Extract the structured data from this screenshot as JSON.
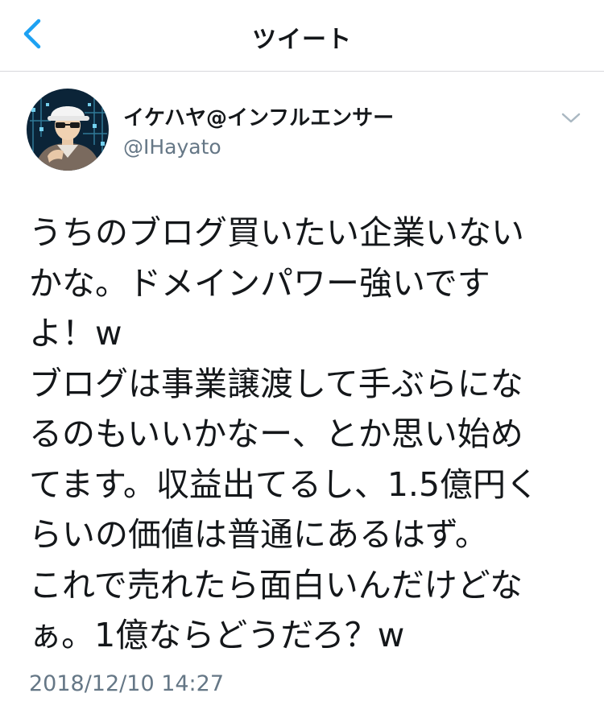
{
  "nav": {
    "title": "ツイート",
    "back_icon": "chevron-left-icon",
    "accent_color": "#1da1f2"
  },
  "tweet": {
    "display_name": "イケハヤ@インフルエンサー",
    "username": "@IHayato",
    "more_icon": "chevron-down-icon",
    "text_lines": [
      "うちのブログ買いたい企業いない",
      "かな。ドメインパワー強いです",
      "よ！w",
      "ブログは事業譲渡して手ぶらにな",
      "るのもいいかなー、とか思い始め",
      "てます。収益出てるし、1.5億円く",
      "らいの価値は普通にあるはず。",
      "これで売れたら面白いんだけどな",
      "ぁ。1億ならどうだろ？w"
    ],
    "timestamp": "2018/12/10 14:27"
  }
}
